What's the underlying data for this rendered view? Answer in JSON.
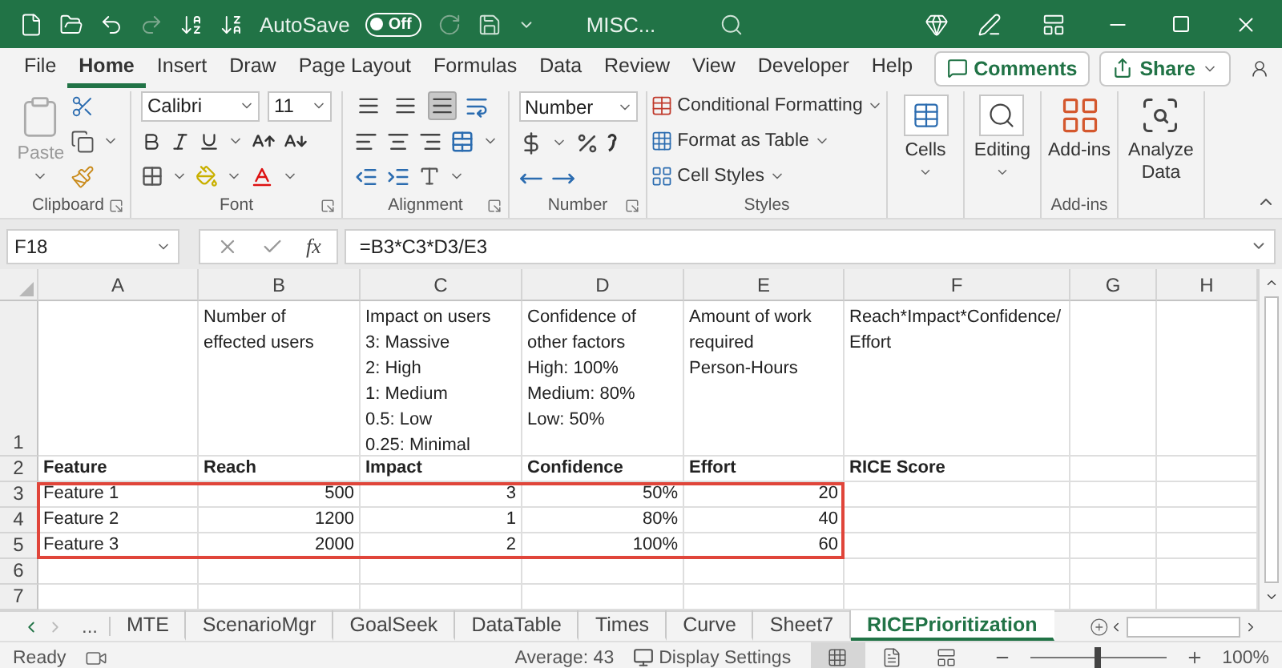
{
  "title_bar": {
    "autosave": {
      "label": "AutoSave",
      "toggle_text": "Off",
      "on": false
    },
    "file_name": "MISC..."
  },
  "ribbon_tabs": [
    {
      "label": "File",
      "selected": false
    },
    {
      "label": "Home",
      "selected": true
    },
    {
      "label": "Insert",
      "selected": false
    },
    {
      "label": "Draw",
      "selected": false
    },
    {
      "label": "Page Layout",
      "selected": false
    },
    {
      "label": "Formulas",
      "selected": false
    },
    {
      "label": "Data",
      "selected": false
    },
    {
      "label": "Review",
      "selected": false
    },
    {
      "label": "View",
      "selected": false
    },
    {
      "label": "Developer",
      "selected": false
    },
    {
      "label": "Help",
      "selected": false
    }
  ],
  "ribbon_actions": {
    "comments": "Comments",
    "share": "Share"
  },
  "ribbon_groups": [
    {
      "kind": "clipboard",
      "label": "Clipboard",
      "paste": {
        "label": "Paste",
        "disabled": true
      }
    },
    {
      "kind": "font",
      "label": "Font",
      "font_name": "Calibri",
      "font_size": "11"
    },
    {
      "kind": "alignment",
      "label": "Alignment",
      "vertical_buttons": [
        {
          "selected": false
        },
        {
          "selected": false
        },
        {
          "selected": true
        }
      ]
    },
    {
      "kind": "number",
      "label": "Number",
      "format": "Number"
    },
    {
      "kind": "styles",
      "label": "Styles",
      "items": [
        "Conditional Formatting",
        "Format as Table",
        "Cell Styles"
      ]
    },
    {
      "kind": "big",
      "button": "Cells",
      "dropdown": true
    },
    {
      "kind": "big",
      "button": "Editing",
      "dropdown": true
    },
    {
      "kind": "big",
      "button": "Add-ins",
      "label": "Add-ins",
      "dropdown": false
    },
    {
      "kind": "big",
      "button": "Analyze\nData",
      "dropdown": false
    }
  ],
  "formula_bar": {
    "name_box": "F18",
    "function_label": "fx",
    "formula": "=B3*C3*D3/E3"
  },
  "sheet": {
    "columns": [
      "A",
      "B",
      "C",
      "D",
      "E",
      "F",
      "G",
      "H"
    ],
    "rows": [
      {
        "header": "1",
        "highlighted": false,
        "cells": [
          {
            "kind": "empty"
          },
          {
            "kind": "note",
            "lines": [
              "Number of",
              "effected users"
            ]
          },
          {
            "kind": "note",
            "lines": [
              "Impact on users",
              "3: Massive",
              "2: High",
              "1: Medium",
              "0.5: Low",
              "0.25: Minimal"
            ]
          },
          {
            "kind": "note",
            "lines": [
              "Confidence of",
              "other factors",
              "High: 100%",
              "Medium: 80%",
              "Low: 50%"
            ]
          },
          {
            "kind": "note",
            "lines": [
              "Amount of work",
              "required",
              "Person-Hours"
            ]
          },
          {
            "kind": "note",
            "lines": [
              "Reach*Impact*Confidence/",
              "Effort"
            ]
          }
        ]
      },
      {
        "header": "2",
        "highlighted": false,
        "cells": [
          {
            "kind": "heading",
            "text": "Feature"
          },
          {
            "kind": "heading",
            "text": "Reach"
          },
          {
            "kind": "heading",
            "text": "Impact"
          },
          {
            "kind": "heading",
            "text": "Confidence"
          },
          {
            "kind": "heading",
            "text": "Effort"
          },
          {
            "kind": "heading",
            "text": "RICE Score"
          }
        ]
      },
      {
        "header": "3",
        "highlighted": true,
        "cells": [
          {
            "kind": "text",
            "text": "Feature 1"
          },
          {
            "kind": "number",
            "text": "500"
          },
          {
            "kind": "number",
            "text": "3"
          },
          {
            "kind": "number",
            "text": "50%"
          },
          {
            "kind": "number",
            "text": "20"
          }
        ]
      },
      {
        "header": "4",
        "highlighted": true,
        "cells": [
          {
            "kind": "text",
            "text": "Feature 2"
          },
          {
            "kind": "number",
            "text": "1200"
          },
          {
            "kind": "number",
            "text": "1"
          },
          {
            "kind": "number",
            "text": "80%"
          },
          {
            "kind": "number",
            "text": "40"
          }
        ]
      },
      {
        "header": "5",
        "highlighted": true,
        "cells": [
          {
            "kind": "text",
            "text": "Feature 3"
          },
          {
            "kind": "number",
            "text": "2000"
          },
          {
            "kind": "number",
            "text": "2"
          },
          {
            "kind": "number",
            "text": "100%"
          },
          {
            "kind": "number",
            "text": "60"
          }
        ]
      },
      {
        "header": "6",
        "highlighted": false
      },
      {
        "header": "7",
        "highlighted": false
      }
    ]
  },
  "sheet_tabs": {
    "overflow": "...",
    "tabs": [
      {
        "label": "MTE",
        "selected": false
      },
      {
        "label": "ScenarioMgr",
        "selected": false
      },
      {
        "label": "GoalSeek",
        "selected": false
      },
      {
        "label": "DataTable",
        "selected": false
      },
      {
        "label": "Times",
        "selected": false
      },
      {
        "label": "Curve",
        "selected": false
      },
      {
        "label": "Sheet7",
        "selected": false
      },
      {
        "label": "RICEPrioritization",
        "selected": true
      }
    ]
  },
  "status_bar": {
    "mode": "Ready",
    "average": "Average: 43",
    "display_settings": "Display Settings",
    "views": [
      {
        "selected": true
      },
      {
        "selected": false
      },
      {
        "selected": false
      }
    ],
    "zoom": {
      "level": 0.5,
      "reading": "100%"
    }
  }
}
